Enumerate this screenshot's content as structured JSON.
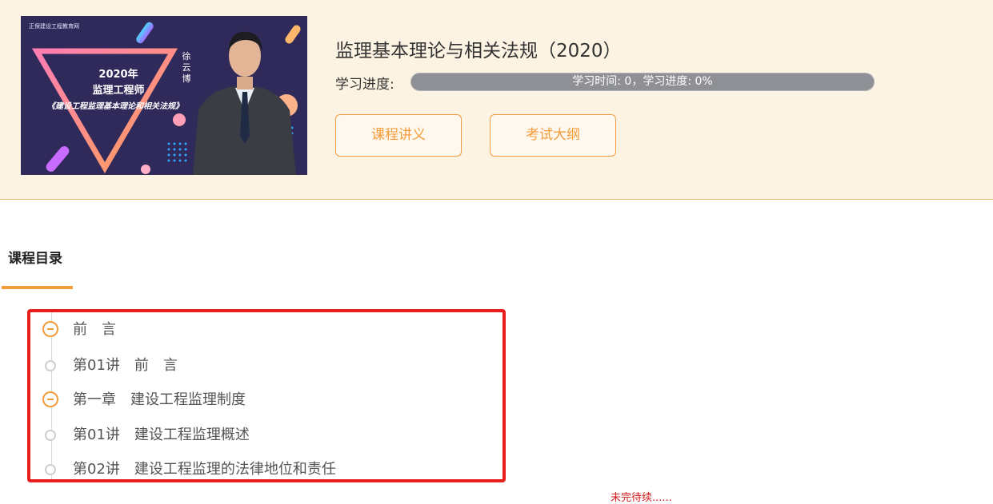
{
  "course": {
    "title": "监理基本理论与相关法规（2020）",
    "cover": {
      "logo_text": "正保建设工程教育网",
      "year_text": "2020年",
      "role_text": "监理工程师",
      "book_text": "《建设工程监理基本理论和相关法规》",
      "teacher_text": "徐云博"
    },
    "progress_label": "学习进度:",
    "progress_text": "学习时间: 0，学习进度: 0%",
    "progress_fraction": 0,
    "buttons": {
      "notes_label": "课程讲义",
      "outline_label": "考试大纲"
    }
  },
  "catalog": {
    "title": "课程目录",
    "items": [
      {
        "type": "chapter",
        "label": "前　言"
      },
      {
        "type": "lesson",
        "label": "第01讲　前　言"
      },
      {
        "type": "chapter",
        "label": "第一章　建设工程监理制度"
      },
      {
        "type": "lesson",
        "label": "第01讲　建设工程监理概述"
      },
      {
        "type": "lesson",
        "label": "第02讲　建设工程监理的法律地位和责任"
      }
    ]
  },
  "footer_note": "未完待续......",
  "colors": {
    "accent": "#f39c3c",
    "header_bg": "#fdf3e3",
    "highlight_border": "#e81e1e",
    "progress_track": "#8e9095"
  }
}
